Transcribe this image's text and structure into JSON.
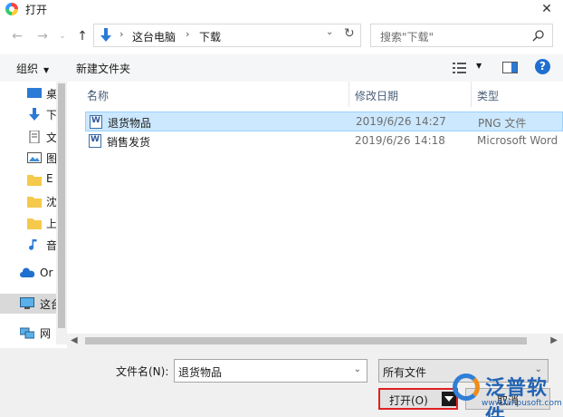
{
  "window": {
    "title": "打开"
  },
  "address": {
    "crumbs": [
      "这台电脑",
      "下载"
    ],
    "search_placeholder": "搜索\"下载\""
  },
  "toolbar": {
    "organize_label": "组织",
    "new_folder_label": "新建文件夹"
  },
  "sidebar": {
    "items": [
      {
        "label": "桌",
        "icon": "desktop-icon"
      },
      {
        "label": "下",
        "icon": "download-icon"
      },
      {
        "label": "文",
        "icon": "document-icon"
      },
      {
        "label": "图",
        "icon": "pictures-icon"
      },
      {
        "label": "E",
        "icon": "folder-icon"
      },
      {
        "label": "沈",
        "icon": "folder-icon"
      },
      {
        "label": "上",
        "icon": "folder-icon"
      },
      {
        "label": "音",
        "icon": "music-icon"
      },
      {
        "label": "Or",
        "icon": "onedrive-icon"
      },
      {
        "label": "这台",
        "icon": "this-pc-icon",
        "selected": true
      },
      {
        "label": "网",
        "icon": "network-icon"
      }
    ]
  },
  "columns": {
    "name": "名称",
    "date": "修改日期",
    "type": "类型"
  },
  "files": [
    {
      "name": "退货物品",
      "date": "2019/6/26 14:27",
      "type": "PNG 文件",
      "selected": true
    },
    {
      "name": "销售发货",
      "date": "2019/6/26 14:18",
      "type": "Microsoft Word"
    }
  ],
  "bottom": {
    "filename_label": "文件名(N):",
    "filename_value": "退货物品",
    "filetype_value": "所有文件",
    "open_label": "打开(O)",
    "cancel_label": "取消"
  },
  "watermark": {
    "text": "泛普软件",
    "url": "www.fanpusoft.com"
  },
  "colors": {
    "selection": "#cce8ff",
    "highlight_border": "#e02020",
    "accent": "#1f6fd0"
  }
}
